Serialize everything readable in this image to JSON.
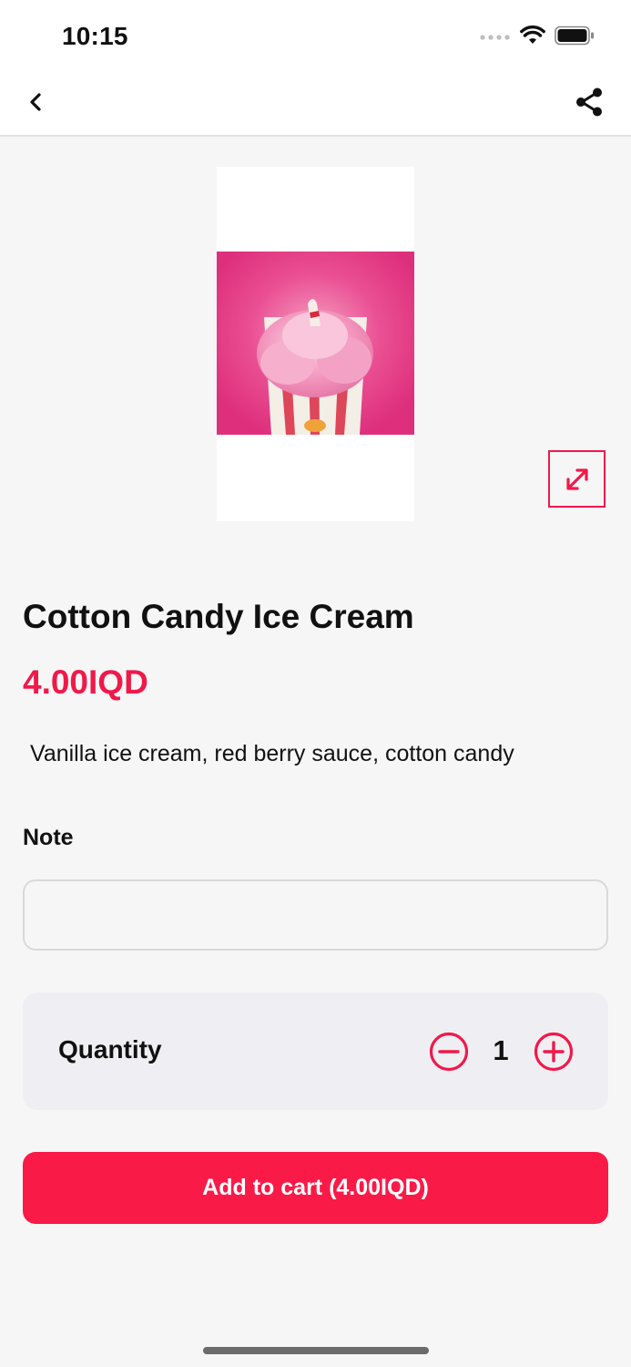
{
  "status_bar": {
    "time": "10:15",
    "icons": [
      "signal-dots-icon",
      "wifi-icon",
      "battery-icon"
    ]
  },
  "nav": {
    "back_icon": "chevron-left-icon",
    "share_icon": "share-icon"
  },
  "product": {
    "image_alt": "cotton candy ice cream cup photo",
    "expand_icon": "expand-arrows-icon",
    "title": "Cotton Candy Ice Cream",
    "price": "4.00IQD",
    "description": "Vanilla ice cream, red berry sauce, cotton candy"
  },
  "note": {
    "label": "Note",
    "value": "",
    "placeholder": ""
  },
  "quantity": {
    "label": "Quantity",
    "value": "1",
    "minus_icon": "minus-circle-icon",
    "plus_icon": "plus-circle-icon"
  },
  "cart": {
    "add_label": "Add to cart (4.00IQD)"
  },
  "colors": {
    "accent": "#f0194a",
    "button": "#fa1a48",
    "background": "#f6f6f7",
    "card": "#efeff3"
  }
}
